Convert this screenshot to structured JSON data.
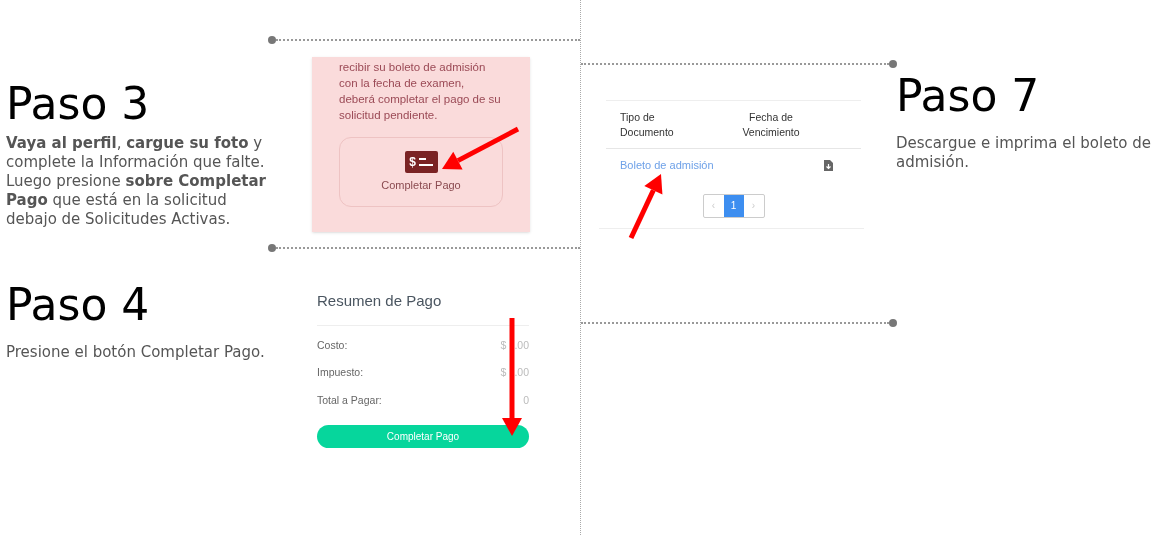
{
  "paso3": {
    "title": "Paso 3",
    "text": "**Vaya al perfil**, **cargue su foto** y complete la Información que falte. Luego presione **sobre Completar Pago** que está en la solicitud debajo de Solicitudes Activas."
  },
  "paso4": {
    "title": "Paso 4",
    "text": "Presione el botón Completar Pago."
  },
  "paso7": {
    "title": "Paso 7",
    "text": "Descargue e imprima el boleto de admisión."
  },
  "solicitud_card": {
    "text": "recibir su boleto de admisión con la fecha de examen, deberá completar el pago de su solicitud pendiente.",
    "button": "Completar Pago",
    "icon_text": "$"
  },
  "resumen": {
    "title": "Resumen de Pago",
    "rows": [
      {
        "label": "Costo:",
        "prefix": "$",
        "suffix": ".00"
      },
      {
        "label": "Impuesto:",
        "prefix": "$",
        "suffix": ".00"
      },
      {
        "label": "Total a Pagar:",
        "suffix": "0"
      }
    ],
    "button": "Completar Pago"
  },
  "documentos": {
    "columns": [
      "Tipo de Documento",
      "Fecha de Vencimiento"
    ],
    "rows": [
      {
        "link": "Boleto de admisión"
      }
    ],
    "pagination": {
      "prev": "‹",
      "pages": [
        {
          "label": "1",
          "selected": true
        }
      ],
      "next": "›"
    }
  }
}
